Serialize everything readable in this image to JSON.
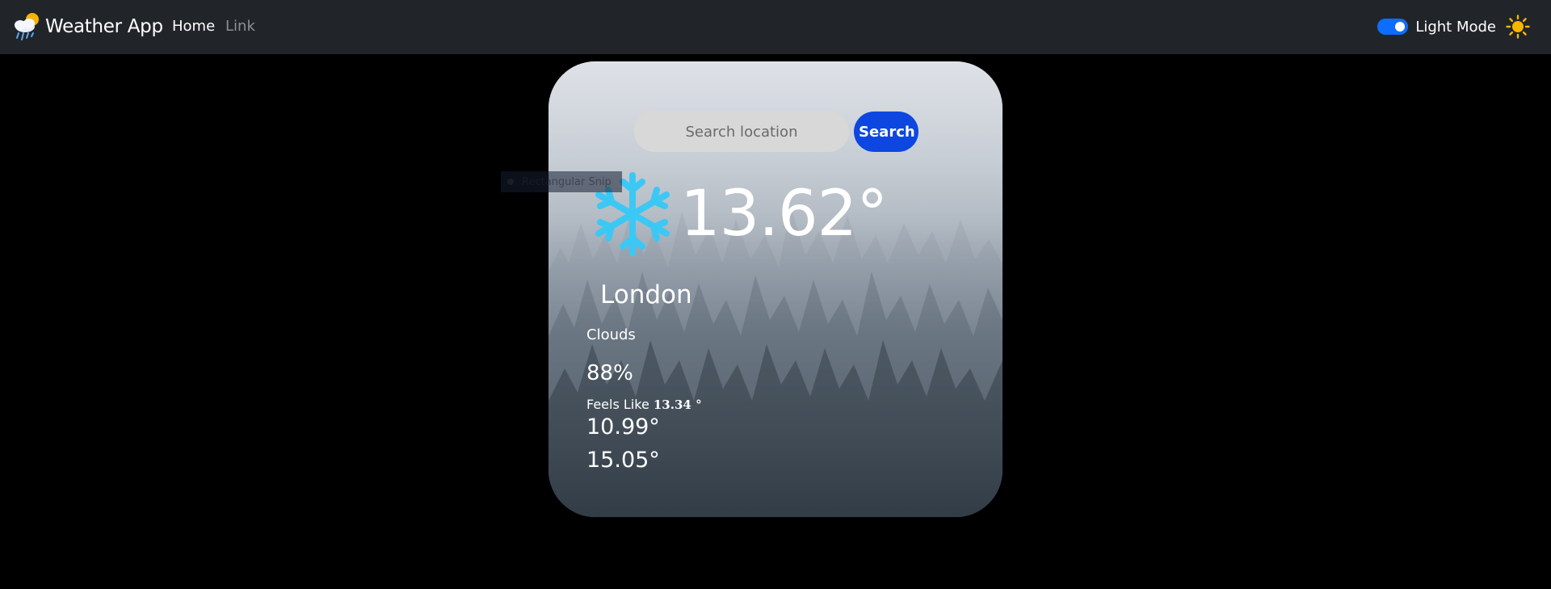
{
  "navbar": {
    "brand": "Weather App",
    "links": [
      {
        "label": "Home",
        "active": true
      },
      {
        "label": "Link",
        "active": false
      }
    ],
    "mode_toggle": {
      "label": "Light Mode",
      "checked": true
    }
  },
  "search": {
    "placeholder": "Search location",
    "value": "",
    "button_label": "Search"
  },
  "weather": {
    "icon": "snowflake-icon",
    "temperature": "13.62°",
    "city": "London",
    "condition": "Clouds",
    "humidity": "88%",
    "feels_like_label": "Feels Like",
    "feels_like_value": "13.34 °",
    "temp_min": "10.99°",
    "temp_max": "15.05°"
  },
  "overlay": {
    "text": "Rectangular Snip"
  },
  "colors": {
    "navbar_bg": "#212529",
    "accent": "#0d6efd",
    "search_button": "#0d47e0",
    "snowflake": "#3cc8f5",
    "sun": "#f7b500"
  }
}
